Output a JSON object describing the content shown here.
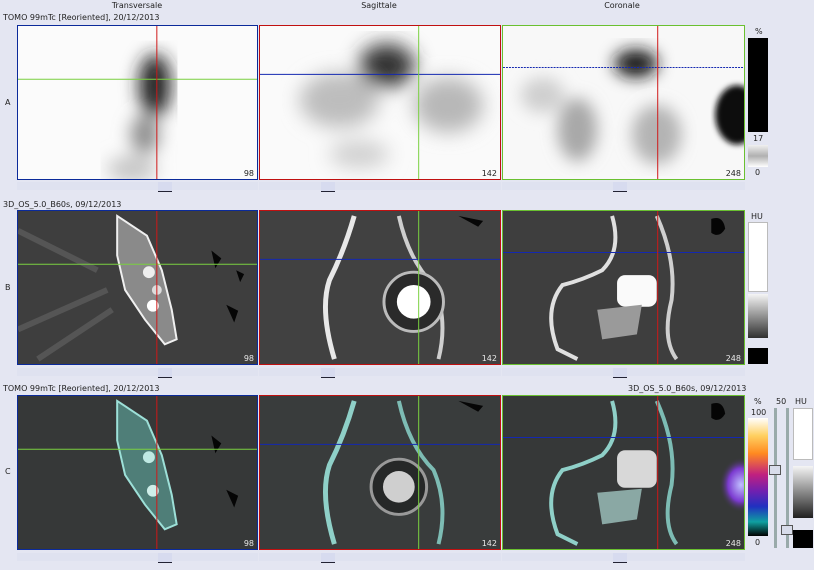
{
  "columns": {
    "transversale": "Transversale",
    "sagittale": "Sagittale",
    "coronale": "Coronale"
  },
  "rows": {
    "a": {
      "label": "A",
      "title": "TOMO 99mTc [Reoriented], 20/12/2013"
    },
    "b": {
      "label": "B",
      "title": "3D_OS_5.0_B60s, 09/12/2013"
    },
    "c": {
      "label": "C",
      "title_left": "TOMO 99mTc [Reoriented], 20/12/2013",
      "title_right": "3D_OS_5.0_B60s, 09/12/2013"
    }
  },
  "slices": {
    "transversale": "98",
    "sagittale": "142",
    "coronale": "248"
  },
  "scale_a": {
    "unit": "%",
    "mid": "17",
    "min": "0"
  },
  "scale_b": {
    "unit": "HU"
  },
  "scale_c": {
    "unit_pct": "%",
    "max": "100",
    "blend": "50",
    "min": "0",
    "unit_hu": "HU"
  },
  "colors": {
    "background": "#e4e6f2",
    "transversale_frame": "#0b2a9a",
    "sagittale_frame": "#c01010",
    "coronale_frame": "#6ac030"
  }
}
